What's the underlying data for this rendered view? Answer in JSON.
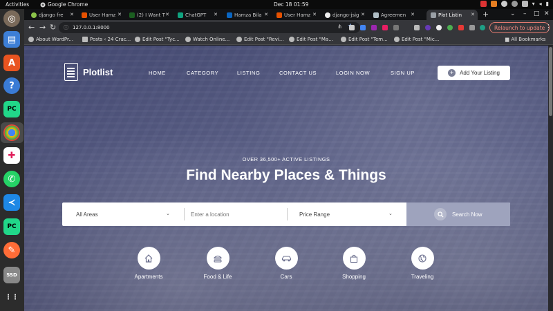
{
  "topbar": {
    "activities": "Activities",
    "app_name": "Google Chrome",
    "clock": "Dec 18  01:59"
  },
  "browser": {
    "tabs": [
      {
        "label": "django fre",
        "color": "#8bc34a"
      },
      {
        "label": "User Hamz",
        "color": "#e65100"
      },
      {
        "label": "(2) I Want T",
        "color": "#1b5e20"
      },
      {
        "label": "ChatGPT",
        "color": "#10a37f"
      },
      {
        "label": "Hamza Bila",
        "color": "#0a66c2"
      },
      {
        "label": "User Hamz",
        "color": "#e65100"
      },
      {
        "label": "django-jsig",
        "color": "#eeeeee"
      },
      {
        "label": "Agreemen",
        "color": "#b0bec5"
      },
      {
        "label": "Plot Listin",
        "color": "#9aa0a6"
      }
    ],
    "url": "127.0.0.1:8000",
    "relaunch_label": "Relaunch to update",
    "bookmarks": [
      "About WordPr...",
      "Posts ‹ 24 Crac...",
      "Edit Post \"Tyc...",
      "Watch Online...",
      "Edit Post \"Revi...",
      "Edit Post \"Ma...",
      "Edit Post \"Tem...",
      "Edit Post \"Mic..."
    ],
    "all_bookmarks": "All Bookmarks"
  },
  "site": {
    "brand": "Plotlist",
    "nav": [
      "HOME",
      "CATEGORY",
      "LISTING",
      "CONTACT US",
      "LOGIN NOW",
      "SIGN UP"
    ],
    "add_listing": "Add Your Listing",
    "kicker": "OVER 36,500+ ACTIVE LISTINGS",
    "title": "Find Nearby Places & Things",
    "search": {
      "area": "All Areas",
      "location_placeholder": "Enter a location",
      "price": "Price Range",
      "button": "Search Now"
    },
    "categories": [
      {
        "label": "Apartments",
        "icon": "home-icon"
      },
      {
        "label": "Food & Life",
        "icon": "burger-icon"
      },
      {
        "label": "Cars",
        "icon": "car-icon"
      },
      {
        "label": "Shopping",
        "icon": "shopping-bag-icon"
      },
      {
        "label": "Traveling",
        "icon": "globe-icon"
      }
    ]
  },
  "colors": {
    "accent": "#9ea3bd",
    "overlay": "#545a88",
    "icon": "#6b6f8e"
  }
}
